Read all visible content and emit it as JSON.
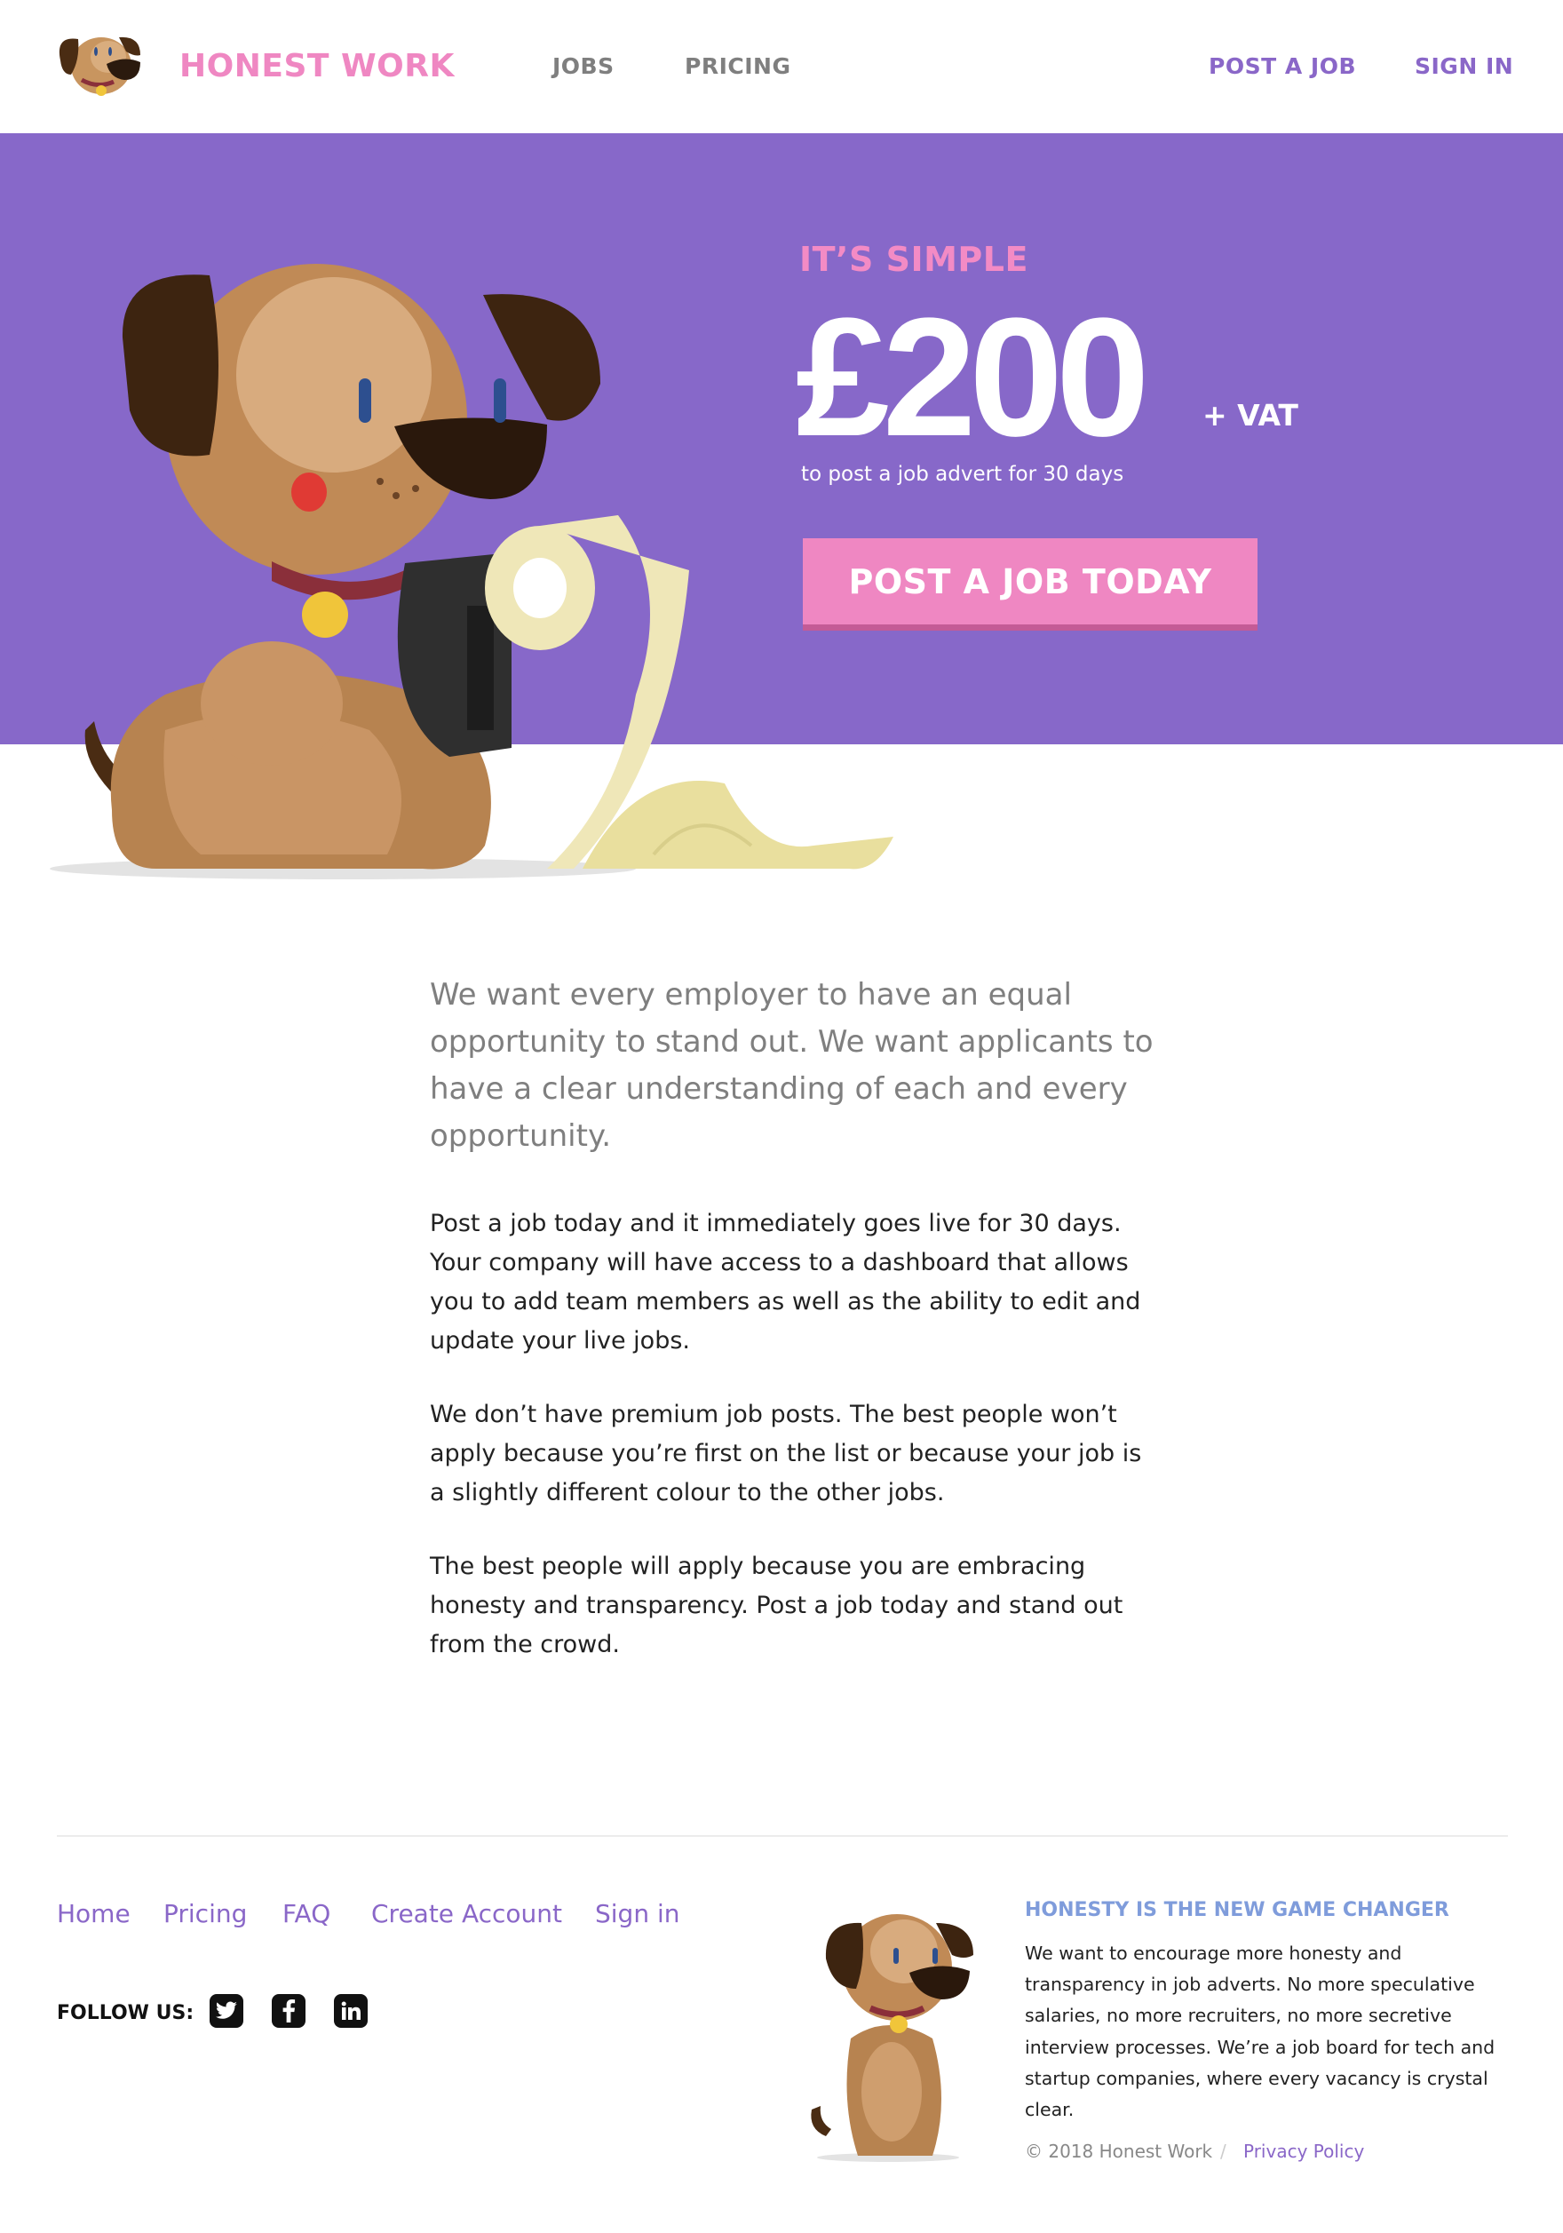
{
  "colors": {
    "brand_pink": "#ef87c2",
    "hero_purple": "#8768c9",
    "link_purple": "#8a67c8",
    "nav_grey": "#7f7f7f",
    "tagline_blue": "#7f9cdb"
  },
  "header": {
    "logo_icon": "dog-mascot-icon",
    "brand": "HONEST WORK",
    "nav": {
      "jobs": "JOBS",
      "pricing": "PRICING"
    },
    "actions": {
      "post_job": "POST A JOB",
      "sign_in": "SIGN IN"
    }
  },
  "hero": {
    "illustration": "dog-with-receipt-illustration",
    "kicker": "IT’S SIMPLE",
    "price": "£200",
    "vat": "+ VAT",
    "subtitle": "to post a job advert for 30 days",
    "cta": "POST A JOB TODAY"
  },
  "content": {
    "lead": "We want every employer to have an equal opportunity to stand out. We want applicants to have a clear understanding of each and every opportunity.",
    "paragraphs": [
      "Post a job today and it immediately goes live for 30 days. Your company will have access to a dashboard that allows you to add team members as well as the ability to edit and update your live jobs.",
      "We don’t have premium job posts. The best people won’t apply because you’re first on the list or because your job is a slightly different colour to the other jobs.",
      "The best people will apply because you are embracing honesty and transparency. Post a job today and stand out from the crowd."
    ]
  },
  "footer": {
    "links": [
      "Home",
      "Pricing",
      "FAQ",
      "Create Account",
      "Sign in"
    ],
    "follow_label": "FOLLOW US:",
    "social_icons": [
      "twitter-icon",
      "facebook-icon",
      "linkedin-icon"
    ],
    "tagline": "HONESTY IS THE NEW GAME CHANGER",
    "about": "We want to encourage more honesty and transparency in job adverts. No more speculative salaries, no more recruiters, no more secretive interview processes. We’re a job board for tech and startup companies, where every vacancy is crystal clear.",
    "copyright": "© 2018 Honest Work",
    "separator": "/",
    "privacy": "Privacy Policy"
  }
}
